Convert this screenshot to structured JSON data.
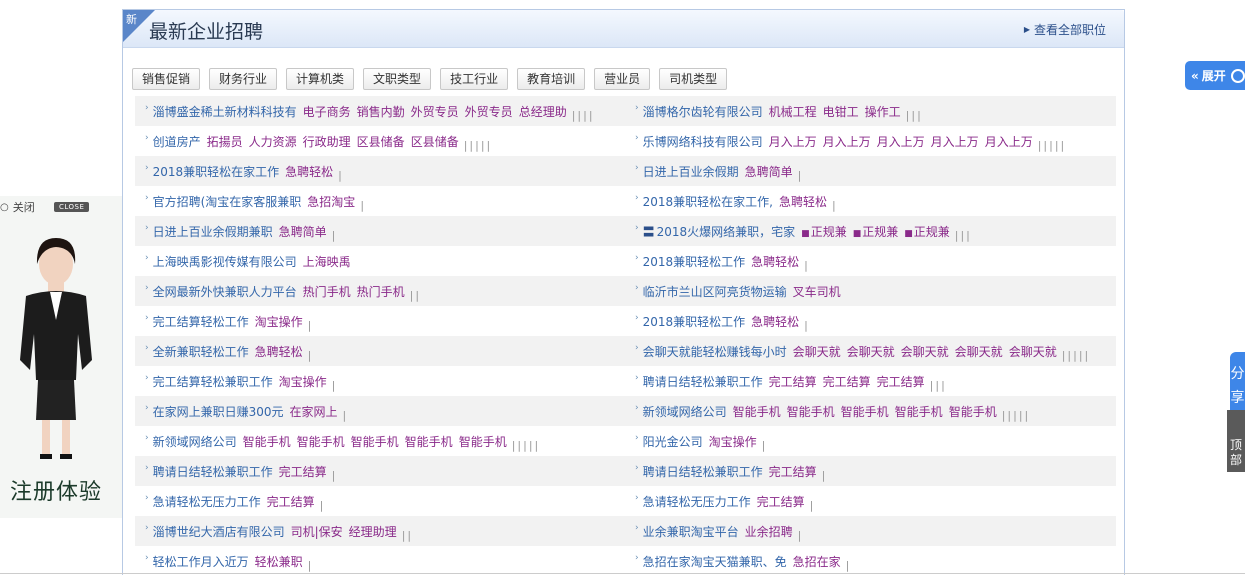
{
  "ad": {
    "close_label": "关闭",
    "close_badge": "CLOSE",
    "cta": "注册体验"
  },
  "panel": {
    "corner_label": "新",
    "title": "最新企业招聘",
    "view_all": "查看全部职位"
  },
  "categories": [
    "销售促销",
    "财务行业",
    "计算机类",
    "文职类型",
    "技工行业",
    "教育培训",
    "营业员",
    "司机类型"
  ],
  "rows": [
    [
      {
        "company": "淄博盛金稀土新材料科技有",
        "tags": [
          "电子商务",
          "销售内勤",
          "外贸专员",
          "外贸专员",
          "总经理助"
        ],
        "pipes": "||||"
      },
      {
        "company": "淄博格尔齿轮有限公司",
        "tags": [
          "机械工程",
          "电钳工",
          "操作工"
        ],
        "pipes": "|||"
      }
    ],
    [
      {
        "company": "创道房产",
        "tags": [
          "拓揚员",
          "人力资源",
          "行政助理",
          "区县储备",
          "区县储备"
        ],
        "pipes": "|||||"
      },
      {
        "company": "乐博网络科技有限公司",
        "tags": [
          "月入上万",
          "月入上万",
          "月入上万",
          "月入上万",
          "月入上万"
        ],
        "pipes": "|||||"
      }
    ],
    [
      {
        "company": "2018兼职轻松在家工作",
        "tags": [
          "急聘轻松"
        ],
        "pipes": "|"
      },
      {
        "company": "日进上百业余假期",
        "tags": [
          "急聘简单"
        ],
        "pipes": "|"
      }
    ],
    [
      {
        "company": "官方招聘(淘宝在家客服兼职",
        "tags": [
          "急招淘宝"
        ],
        "pipes": "|"
      },
      {
        "company": "2018兼职轻松在家工作,",
        "tags": [
          "急聘轻松"
        ],
        "pipes": "|"
      }
    ],
    [
      {
        "company": "日进上百业余假期兼职",
        "tags": [
          "急聘简单"
        ],
        "pipes": "|"
      },
      {
        "company": "2018火爆网络兼职，宅家",
        "flag": "〓",
        "sq": [
          "正规兼",
          "正规兼",
          "正规兼"
        ],
        "pipes": "|||"
      }
    ],
    [
      {
        "company": "上海映禹影视传媒有限公司",
        "tags": [
          "上海映禹"
        ],
        "pipes": ""
      },
      {
        "company": "2018兼职轻松工作",
        "tags": [
          "急聘轻松"
        ],
        "pipes": "|"
      }
    ],
    [
      {
        "company": "全网最新外快兼职人力平台",
        "tags": [
          "热门手机",
          "热门手机"
        ],
        "pipes": "||"
      },
      {
        "company": "临沂市兰山区阿亮货物运输",
        "tags": [
          "叉车司机"
        ],
        "pipes": ""
      }
    ],
    [
      {
        "company": "完工结算轻松工作",
        "tags": [
          "淘宝操作"
        ],
        "pipes": "|"
      },
      {
        "company": "2018兼职轻松工作",
        "tags": [
          "急聘轻松"
        ],
        "pipes": "|"
      }
    ],
    [
      {
        "company": "全新兼职轻松工作",
        "tags": [
          "急聘轻松"
        ],
        "pipes": "|"
      },
      {
        "company": "会聊天就能轻松赚钱每小时",
        "tags": [
          "会聊天就",
          "会聊天就",
          "会聊天就",
          "会聊天就",
          "会聊天就"
        ],
        "pipes": "|||||"
      }
    ],
    [
      {
        "company": "完工结算轻松兼职工作",
        "tags": [
          "淘宝操作"
        ],
        "pipes": "|"
      },
      {
        "company": "聘请日结轻松兼职工作",
        "tags": [
          "完工结算",
          "完工结算",
          "完工结算"
        ],
        "pipes": "|||"
      }
    ],
    [
      {
        "company": "在家网上兼职日赚300元",
        "tags": [
          "在家网上"
        ],
        "pipes": "|"
      },
      {
        "company": "新领域网络公司",
        "tags": [
          "智能手机",
          "智能手机",
          "智能手机",
          "智能手机",
          "智能手机"
        ],
        "pipes": "|||||"
      }
    ],
    [
      {
        "company": "新领域网络公司",
        "tags": [
          "智能手机",
          "智能手机",
          "智能手机",
          "智能手机",
          "智能手机"
        ],
        "pipes": "|||||"
      },
      {
        "company": "阳光金公司",
        "tags": [
          "淘宝操作"
        ],
        "pipes": "|"
      }
    ],
    [
      {
        "company": "聘请日结轻松兼职工作",
        "tags": [
          "完工结算"
        ],
        "pipes": "|"
      },
      {
        "company": "聘请日结轻松兼职工作",
        "tags": [
          "完工结算"
        ],
        "pipes": "|"
      }
    ],
    [
      {
        "company": "急请轻松无压力工作",
        "tags": [
          "完工结算"
        ],
        "pipes": "|"
      },
      {
        "company": "急请轻松无压力工作",
        "tags": [
          "完工结算"
        ],
        "pipes": "|"
      }
    ],
    [
      {
        "company": "淄博世纪大酒店有限公司",
        "tags": [
          "司机|保安",
          "经理助理"
        ],
        "pipes": "||"
      },
      {
        "company": "业余兼职淘宝平台",
        "tags": [
          "业余招聘"
        ],
        "pipes": "|"
      }
    ],
    [
      {
        "company": "轻松工作月入近万",
        "tags": [
          "轻松兼职"
        ],
        "pipes": "|"
      },
      {
        "company": "急招在家淘宝天猫兼职、免",
        "tags": [
          "急招在家"
        ],
        "pipes": "|"
      }
    ]
  ],
  "widgets": {
    "expand": "展开",
    "share": "分享",
    "top": "顶部"
  }
}
